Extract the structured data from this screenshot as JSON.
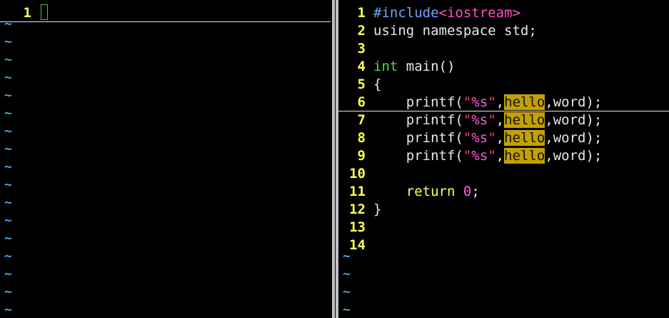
{
  "left_pane": {
    "line_numbers": [
      "1"
    ],
    "tilde": "~"
  },
  "right_pane": {
    "line_numbers": [
      "1",
      "2",
      "3",
      "4",
      "5",
      "6",
      "7",
      "8",
      "9",
      "10",
      "11",
      "12",
      "13",
      "14"
    ],
    "code": {
      "l1_directive": "#include",
      "l1_header": "<iostream>",
      "l2": "using namespace std;",
      "l4_type": "int",
      "l4_rest": " main()",
      "l5": "{",
      "printf_indent": "    printf(",
      "quote_open": "\"",
      "format": "%s",
      "quote_close": "\"",
      "comma1": ",",
      "search_match": "hello",
      "printf_tail": ",word);",
      "return_kw": "return",
      "return_val": "0",
      "return_semicolon": ";",
      "l12": "}"
    },
    "tilde": "~"
  },
  "colors": {
    "line_number": "#ffff55",
    "tilde": "#4aa3d6",
    "search_highlight": "#c4a000",
    "string": "#ff3d6f",
    "type": "#4cdc4c",
    "preprocessor": "#6fa8ff"
  }
}
